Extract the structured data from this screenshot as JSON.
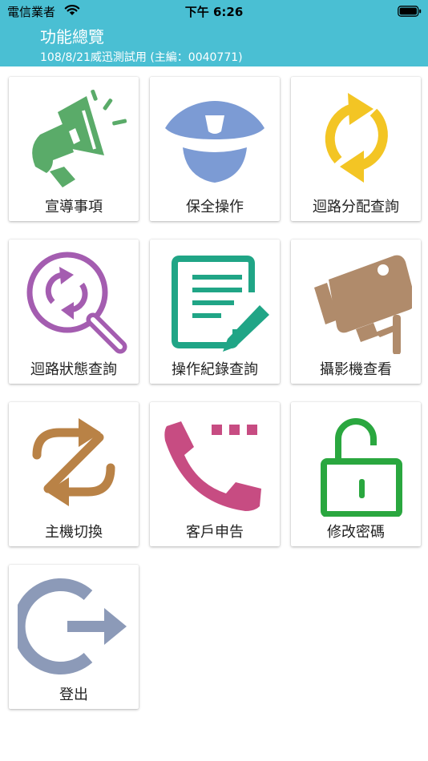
{
  "status_bar": {
    "carrier": "電信業者",
    "time": "下午 6:26"
  },
  "header": {
    "title": "功能總覽",
    "subtitle": "108/8/21威迅測試用 (主編：0040771)"
  },
  "tiles": [
    {
      "label": "宣導事項",
      "icon": "megaphone-icon",
      "color": "#5aab69"
    },
    {
      "label": "保全操作",
      "icon": "security-cap-icon",
      "color": "#7c9bd4"
    },
    {
      "label": "迴路分配查詢",
      "icon": "sync-arrows-icon",
      "color": "#f3c524"
    },
    {
      "label": "迴路狀態查詢",
      "icon": "search-refresh-icon",
      "color": "#a45db0"
    },
    {
      "label": "操作紀錄查詢",
      "icon": "document-edit-icon",
      "color": "#20a586"
    },
    {
      "label": "攝影機查看",
      "icon": "camera-icon",
      "color": "#b08b6b"
    },
    {
      "label": "主機切換",
      "icon": "switch-arrows-icon",
      "color": "#b98246"
    },
    {
      "label": "客戶申告",
      "icon": "phone-icon",
      "color": "#c74c82"
    },
    {
      "label": "修改密碼",
      "icon": "unlock-icon",
      "color": "#2aa73f"
    },
    {
      "label": "登出",
      "icon": "logout-icon",
      "color": "#8c9ab8"
    }
  ]
}
